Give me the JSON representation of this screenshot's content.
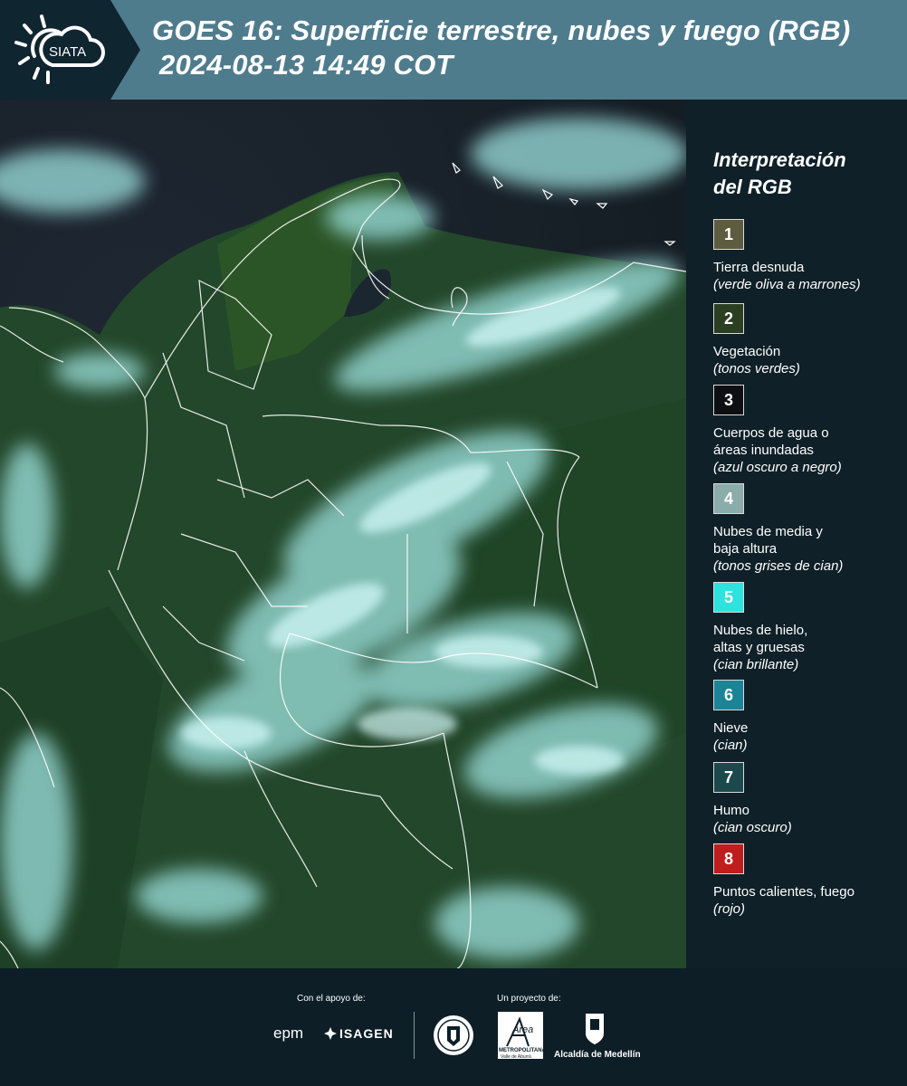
{
  "header": {
    "logo_text": "SIATA",
    "title": "GOES 16: Superficie terrestre, nubes y fuego (RGB)",
    "datetime": "2024-08-13 14:49 COT"
  },
  "legend": {
    "title_line1": "Interpretación",
    "title_line2": "del RGB",
    "items": [
      {
        "num": "1",
        "label": "Tierra desnuda",
        "desc": "(verde oliva a marrones)",
        "color": "#5e5c40"
      },
      {
        "num": "2",
        "label": "Vegetación",
        "desc": "(tonos verdes)",
        "color": "#2b3f22"
      },
      {
        "num": "3",
        "label": "Cuerpos de agua o",
        "label2": "áreas inundadas",
        "desc": "(azul oscuro a negro)",
        "color": "#0d0f12"
      },
      {
        "num": "4",
        "label": "Nubes de media y",
        "label2": "baja altura",
        "desc": "(tonos grises de cian)",
        "color": "#8aacab"
      },
      {
        "num": "5",
        "label": "Nubes de hielo,",
        "label2": "altas y gruesas",
        "desc": "(cian brillante)",
        "color": "#2de3e0"
      },
      {
        "num": "6",
        "label": "Nieve",
        "desc": "(cian)",
        "color": "#1c8497"
      },
      {
        "num": "7",
        "label": "Humo",
        "desc": "(cian oscuro)",
        "color": "#1c4a4c"
      },
      {
        "num": "8",
        "label": "Puntos calientes, fuego",
        "desc": "(rojo)",
        "color": "#c01d1d"
      }
    ]
  },
  "footer": {
    "support_label": "Con el apoyo de:",
    "project_label": "Un proyecto de:",
    "sponsor1": "epm",
    "sponsor2": "ISAGEN",
    "partner1_name": "Área",
    "partner1_sub": "METROPOLITANA",
    "partner1_sub2": "Valle de Aburrá",
    "partner2": "Alcaldía de Medellín"
  }
}
